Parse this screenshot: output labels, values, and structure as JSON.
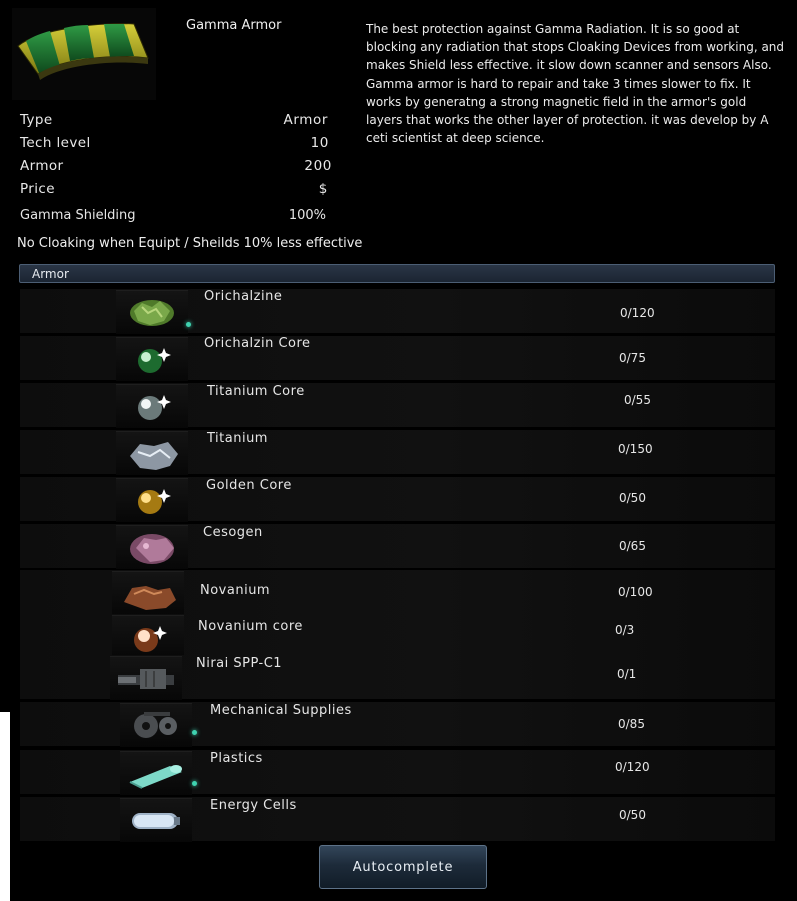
{
  "item": {
    "title": "Gamma Armor",
    "description": "The best protection against Gamma Radiation. It is so good at blocking  any radiation that stops Cloaking Devices from working, and makes Shield less effective. it slow down scanner and sensors Also. Gamma armor is hard to repair and take 3 times slower to fix. It works by generatng a strong magnetic field in the armor's gold layers that works the other layer of protection.  it was develop by A ceti scientist at deep science."
  },
  "stats": [
    {
      "label": "Type",
      "value": "Armor"
    },
    {
      "label": "Tech level",
      "value": "10"
    },
    {
      "label": "Armor",
      "value": "200"
    },
    {
      "label": "Price",
      "value": "$"
    }
  ],
  "shielding": {
    "label": "Gamma Shielding",
    "value": "100%"
  },
  "warning": "No Cloaking when Equipt / Sheilds 10% less effective",
  "section_title": "Armor",
  "materials": [
    {
      "name": "Orichalzine",
      "count": "0/120",
      "icon": "green-ore-icon"
    },
    {
      "name": "Orichalzin Core",
      "count": "0/75",
      "icon": "green-core-orb-icon"
    },
    {
      "name": "Titanium Core",
      "count": "0/55",
      "icon": "silver-core-orb-icon"
    },
    {
      "name": "Titanium",
      "count": "0/150",
      "icon": "titanium-ore-icon"
    },
    {
      "name": "Golden Core",
      "count": "0/50",
      "icon": "golden-core-orb-icon"
    },
    {
      "name": "Cesogen",
      "count": "0/65",
      "icon": "pink-crystal-ore-icon"
    },
    {
      "name": "Novanium",
      "count": "0/100",
      "icon": "copper-ore-icon"
    },
    {
      "name": "Novanium core",
      "count": "0/3",
      "icon": "copper-core-orb-icon"
    },
    {
      "name": "Nirai SPP-C1",
      "count": "0/1",
      "icon": "mechanical-part-icon"
    },
    {
      "name": "Mechanical Supplies",
      "count": "0/85",
      "icon": "gear-chain-icon"
    },
    {
      "name": "Plastics",
      "count": "0/120",
      "icon": "plastic-roll-icon"
    },
    {
      "name": "Energy Cells",
      "count": "0/50",
      "icon": "energy-cell-icon"
    }
  ],
  "autocomplete_label": "Autocomplete",
  "colors": {
    "accent": "#3fd2b0",
    "bar": "#2a3646",
    "button": "#1d2b3a"
  }
}
